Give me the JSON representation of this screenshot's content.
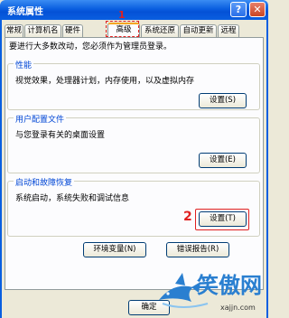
{
  "window": {
    "title": "系统属性"
  },
  "tabs": [
    "常规",
    "计算机名",
    "硬件",
    "高级",
    "系统还原",
    "自动更新",
    "远程"
  ],
  "active_tab": "高级",
  "admin_note": "要进行大多数改动，您必须作为管理员登录。",
  "groups": {
    "performance": {
      "title": "性能",
      "desc": "视觉效果，处理器计划，内存使用，以及虚拟内存",
      "button": "设置(S)"
    },
    "profile": {
      "title": "用户配置文件",
      "desc": "与您登录有关的桌面设置",
      "button": "设置(E)"
    },
    "startup": {
      "title": "启动和故障恢复",
      "desc": "系统启动，系统失败和调试信息",
      "button": "设置(T)"
    }
  },
  "env_button": "环境变量(N)",
  "error_button": "错误报告(R)",
  "ok_button": "确定",
  "annotations": {
    "step1": "1",
    "step2": "2"
  },
  "watermark": {
    "text": "笑傲网",
    "url": "xajjn.com"
  }
}
